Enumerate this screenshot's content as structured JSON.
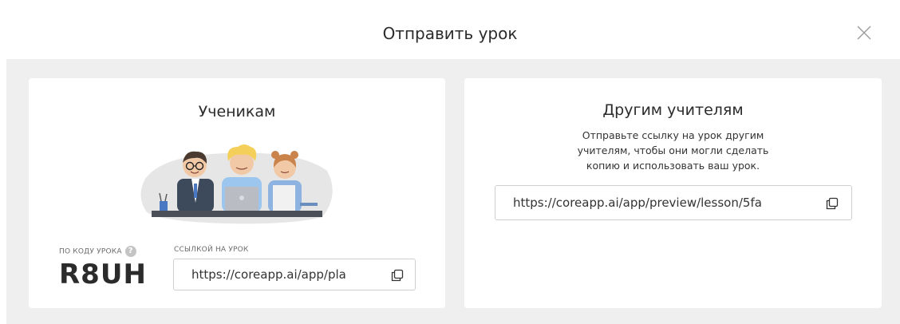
{
  "dialog": {
    "title": "Отправить урок"
  },
  "students_card": {
    "title": "Ученикам",
    "code_label": "ПО КОДУ УРОКА",
    "help_glyph": "?",
    "code": "R8UH",
    "link_label": "ССЫЛКОЙ НА УРОК",
    "link_value": "https://coreapp.ai/app/pla"
  },
  "teachers_card": {
    "title": "Другим учителям",
    "desc_line1": "Отправьте ссылку на урок другим",
    "desc_line2": "учителям, чтобы они могли сделать",
    "desc_line3": "копию и использовать ваш урок.",
    "link_value": "https://coreapp.ai/app/preview/lesson/5fa"
  },
  "icons": {
    "close": "close-icon",
    "copy": "copy-icon",
    "help": "question-icon"
  },
  "colors": {
    "background": "#efefef",
    "card": "#ffffff",
    "text": "#2b2b2b",
    "border": "#cfcfcf"
  }
}
